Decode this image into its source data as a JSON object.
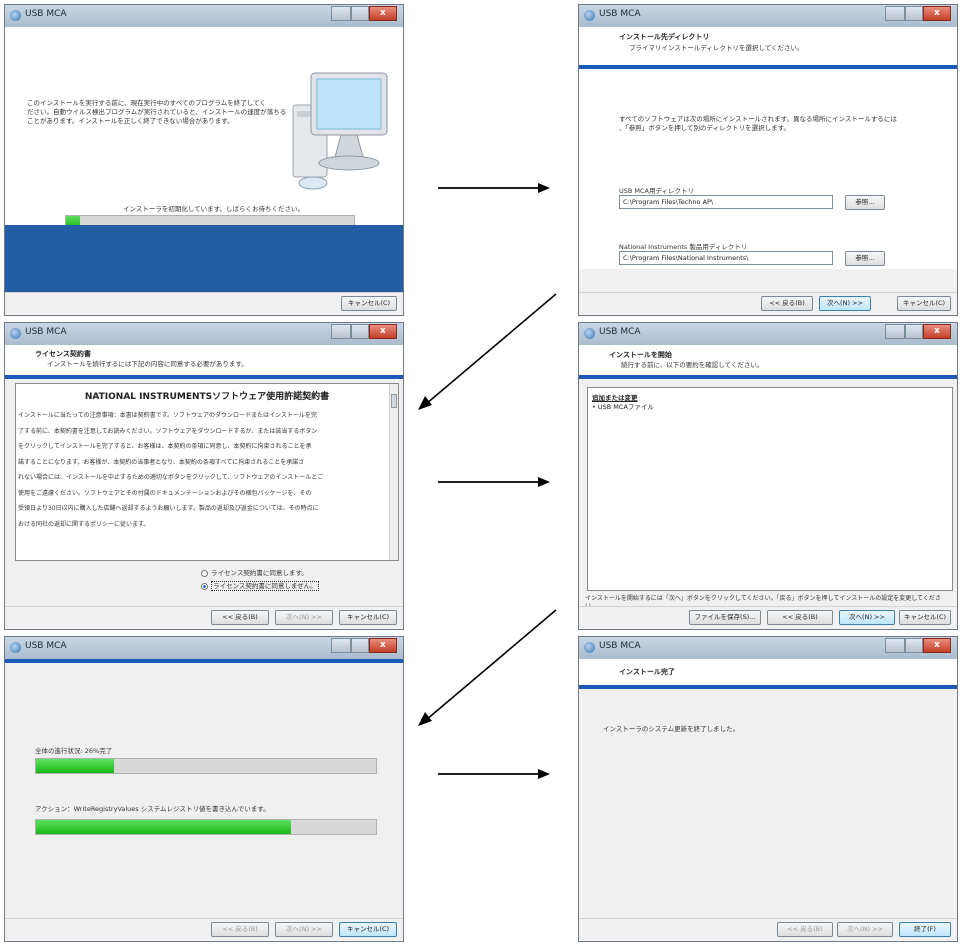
{
  "app": {
    "window_title": "USB MCA",
    "close_glyph": "x",
    "buttons": {
      "back": "<< 戻る(B)",
      "next": "次へ(N) >>",
      "cancel": "キャンセル(C)",
      "browse": "参照...",
      "save_file": "ファイルを保存(S)...",
      "finish": "終了(F)"
    }
  },
  "screens": {
    "init": {
      "message_lines": [
        "このインストールを実行する前に、現在実行中のすべてのプログラムを終了してく",
        "ださい。自動ウイルス検出プログラムが実行されていると、インストールの速度が落ちる",
        "ことがあります。インストールを正しく終了できない場合があります。"
      ],
      "status": "インストーラを初期化しています。しばらくお待ちください。",
      "progress_fraction": 0.05
    },
    "directory": {
      "header_title": "インストール先ディレクトリ",
      "header_subtitle": "プライマリインストールディレクトリを選択してください。",
      "info_lines": [
        "すべてのソフトウェアは次の場所にインストールされます。異なる場所にインストールするには",
        "、「参照」ボタンを押して別のディレクトリを選択します。"
      ],
      "usb_dir_label": "USB MCA用ディレクトリ",
      "usb_dir_value": "C:\\Program Files\\Techno AP\\",
      "ni_dir_label": "National Instruments 製品用ディレクトリ",
      "ni_dir_value": "C:\\Program Files\\National Instruments\\"
    },
    "license": {
      "header_title": "ライセンス契約書",
      "header_subtitle": "インストールを続行するには下記の内容に同意する必要があります。",
      "agreement_title": "NATIONAL INSTRUMENTSソフトウェア使用許諾契約書",
      "agreement_lines": [
        "インストールに当たっての注意事項：本書は契約書です。ソフトウェアのダウンロードまたはインストールを完",
        "了する前に、本契約書を注意してお読みください。ソフトウェアをダウンロードするか、または該当するボタン",
        "をクリックしてインストールを完了すると、お客様は、本契約の条項に同意し、本契約に拘束されることを承",
        "諾することになります。お客様が、本契約の当事者となり、本契約の条項すべてに拘束されることを承諾さ",
        "れない場合には、インストールを中止するための適切なボタンをクリックして、ソフトウェアのインストールとご",
        "使用をご遠慮ください。ソフトウェアとその付属のドキュメンテーションおよびその梱包パッケージを、その",
        "受領日より30日以内に購入した店舗へ返却するようお願いします。製品の返却及び返金については、その時点に",
        "おける同社の返却に関するポリシーに従います。"
      ],
      "accept_option": "ライセンス契約書に同意します。",
      "decline_option": "ライセンス契約書に同意しません。"
    },
    "summary": {
      "header_title": "インストールを開始",
      "header_subtitle": "続行する前に、以下の要約を確認してください。",
      "list_heading": "追加または変更",
      "list_items": [
        "• USB MCAファイル"
      ],
      "footer_note_line1": "インストールを開始するには「次へ」ボタンをクリックしてください。「戻る」ボタンを押してインストールの設定を変更してくださ",
      "footer_note_line2": "い。"
    },
    "progress": {
      "overall_label": "全体の進行状況: 26%完了",
      "overall_fraction": 0.23,
      "action_label": "アクション：WriteRegistryValues システムレジストリ値を書き込んでいます。",
      "action_fraction": 0.75
    },
    "complete": {
      "header_title": "インストール完了",
      "message": "インストーラのシステム更新を終了しました。"
    }
  }
}
